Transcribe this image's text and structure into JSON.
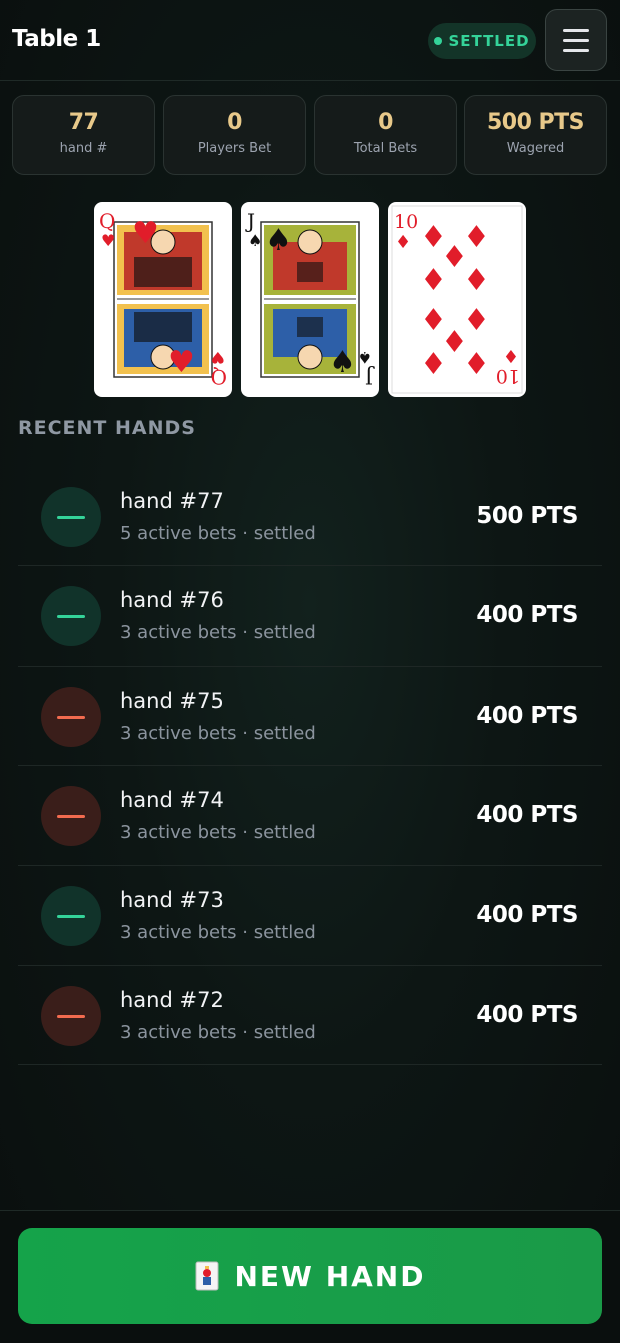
{
  "header": {
    "title": "Table 1",
    "status": "SETTLED",
    "menu_icon": "hamburger-menu-icon"
  },
  "stats": [
    {
      "value": "77",
      "label": "hand #"
    },
    {
      "value": "0",
      "label": "Players Bet"
    },
    {
      "value": "0",
      "label": "Total Bets"
    },
    {
      "value": "500 PTS",
      "label": "Wagered"
    }
  ],
  "cards": [
    {
      "rank": "Q",
      "suit": "hearts",
      "suit_symbol": "♥",
      "color": "#e11d2a"
    },
    {
      "rank": "J",
      "suit": "spades",
      "suit_symbol": "♠",
      "color": "#111111"
    },
    {
      "rank": "10",
      "suit": "diamonds",
      "suit_symbol": "♦",
      "color": "#e11d2a"
    }
  ],
  "recent": {
    "title": "RECENT HANDS",
    "hands": [
      {
        "title": "hand #77",
        "subtitle": "5 active bets · settled",
        "amount": "500 PTS",
        "result": "win"
      },
      {
        "title": "hand #76",
        "subtitle": "3 active bets · settled",
        "amount": "400 PTS",
        "result": "win"
      },
      {
        "title": "hand #75",
        "subtitle": "3 active bets · settled",
        "amount": "400 PTS",
        "result": "loss"
      },
      {
        "title": "hand #74",
        "subtitle": "3 active bets · settled",
        "amount": "400 PTS",
        "result": "loss"
      },
      {
        "title": "hand #73",
        "subtitle": "3 active bets · settled",
        "amount": "400 PTS",
        "result": "win"
      },
      {
        "title": "hand #72",
        "subtitle": "3 active bets · settled",
        "amount": "400 PTS",
        "result": "loss"
      }
    ]
  },
  "action": {
    "label": "NEW HAND",
    "icon": "joker-card-icon"
  },
  "colors": {
    "accent_green": "#34d399",
    "loss_red": "#f26b4f",
    "gold": "#e8c98a",
    "button_green": "#16a34a"
  }
}
